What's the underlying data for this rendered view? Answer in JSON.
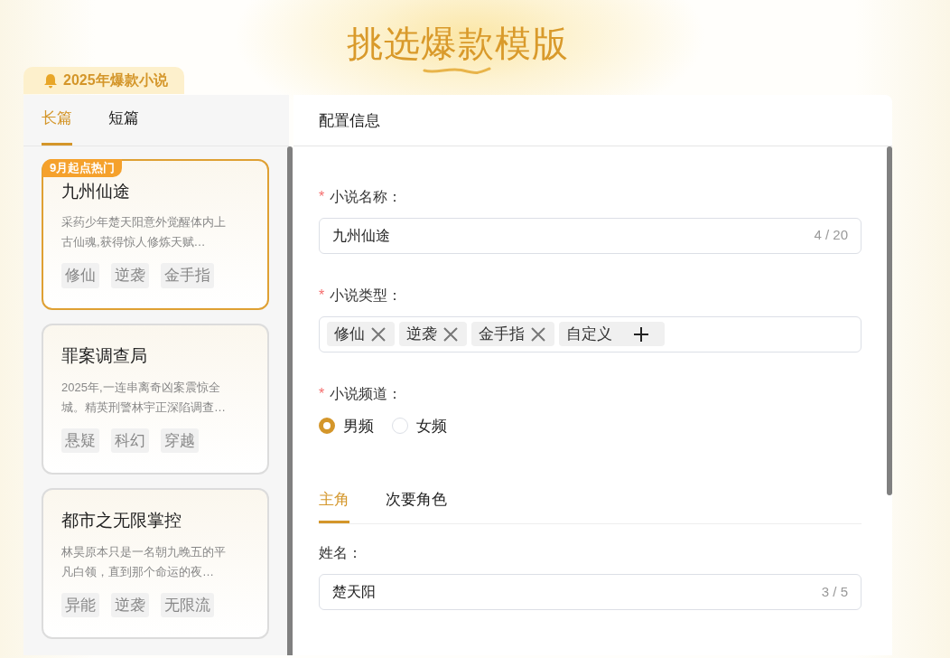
{
  "page_title": "挑选爆款模版",
  "category_badge": "2025年爆款小说",
  "list_tabs": [
    {
      "label": "长篇",
      "selected": true
    },
    {
      "label": "短篇",
      "selected": false
    }
  ],
  "novels": [
    {
      "ribbon": "9月起点热门",
      "title": "九州仙途",
      "description": "采药少年楚天阳意外觉醒体内上古仙魂,获得惊人修炼天赋…",
      "tags": [
        "修仙",
        "逆袭",
        "金手指"
      ],
      "selected": true
    },
    {
      "title": "罪案调查局",
      "description": "2025年,一连串离奇凶案震惊全城。精英刑警林宇正深陷调查…",
      "tags": [
        "悬疑",
        "科幻",
        "穿越"
      ],
      "selected": false
    },
    {
      "title": "都市之无限掌控",
      "description": "林昊原本只是一名朝九晚五的平凡白领，直到那个命运的夜…",
      "tags": [
        "异能",
        "逆袭",
        "无限流"
      ],
      "selected": false
    }
  ],
  "config": {
    "title": "配置信息",
    "fields": [
      {
        "kind": "text",
        "label": "小说名称：",
        "required_mark": "*",
        "value": "九州仙途",
        "counter": "4 / 20"
      },
      {
        "kind": "tags",
        "label": "小说类型：",
        "required_mark": "*",
        "tags": [
          "修仙",
          "逆袭",
          "金手指"
        ],
        "add_label": "自定义"
      },
      {
        "kind": "radio",
        "label": "小说频道：",
        "required_mark": "*",
        "options": [
          {
            "label": "男频",
            "selected": true
          },
          {
            "label": "女频",
            "selected": false
          }
        ]
      }
    ],
    "role_tabs": [
      {
        "label": "主角",
        "selected": true
      },
      {
        "label": "次要角色",
        "selected": false
      }
    ],
    "role_fields": [
      {
        "kind": "text",
        "label": "姓名：",
        "value": "楚天阳",
        "counter": "3 / 5"
      }
    ]
  }
}
